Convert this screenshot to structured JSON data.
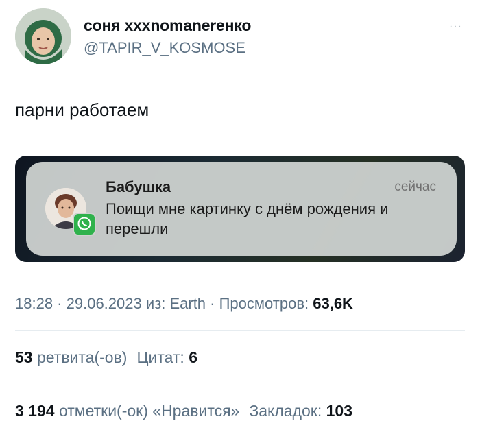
{
  "author": {
    "display_name": "соня xxxnomanerенко",
    "handle": "@TAPIR_V_KOSMOSE",
    "more_label": "···"
  },
  "tweet": {
    "text": "парни работаем"
  },
  "notification": {
    "sender": "Бабушка",
    "time": "сейчас",
    "message": "Поищи мне картинку с днём рождения и перешли",
    "app_icon": "whatsapp-icon"
  },
  "meta": {
    "time": "18:28",
    "sep1": " · ",
    "date": "29.06.2023",
    "source_prefix": " из: ",
    "source": "Earth",
    "sep2": " · ",
    "views_label": "Просмотров: ",
    "views": "63,6K"
  },
  "stats": {
    "retweets": "53",
    "retweets_label": " ретвита(-ов)",
    "quotes_label": "Цитат: ",
    "quotes": "6",
    "likes": "3 194",
    "likes_label": " отметки(-ок) «Нравится»",
    "bookmarks_label": "Закладок: ",
    "bookmarks": "103"
  },
  "colors": {
    "secondary_text": "#5b7083",
    "whatsapp_green": "#2fb24c"
  }
}
